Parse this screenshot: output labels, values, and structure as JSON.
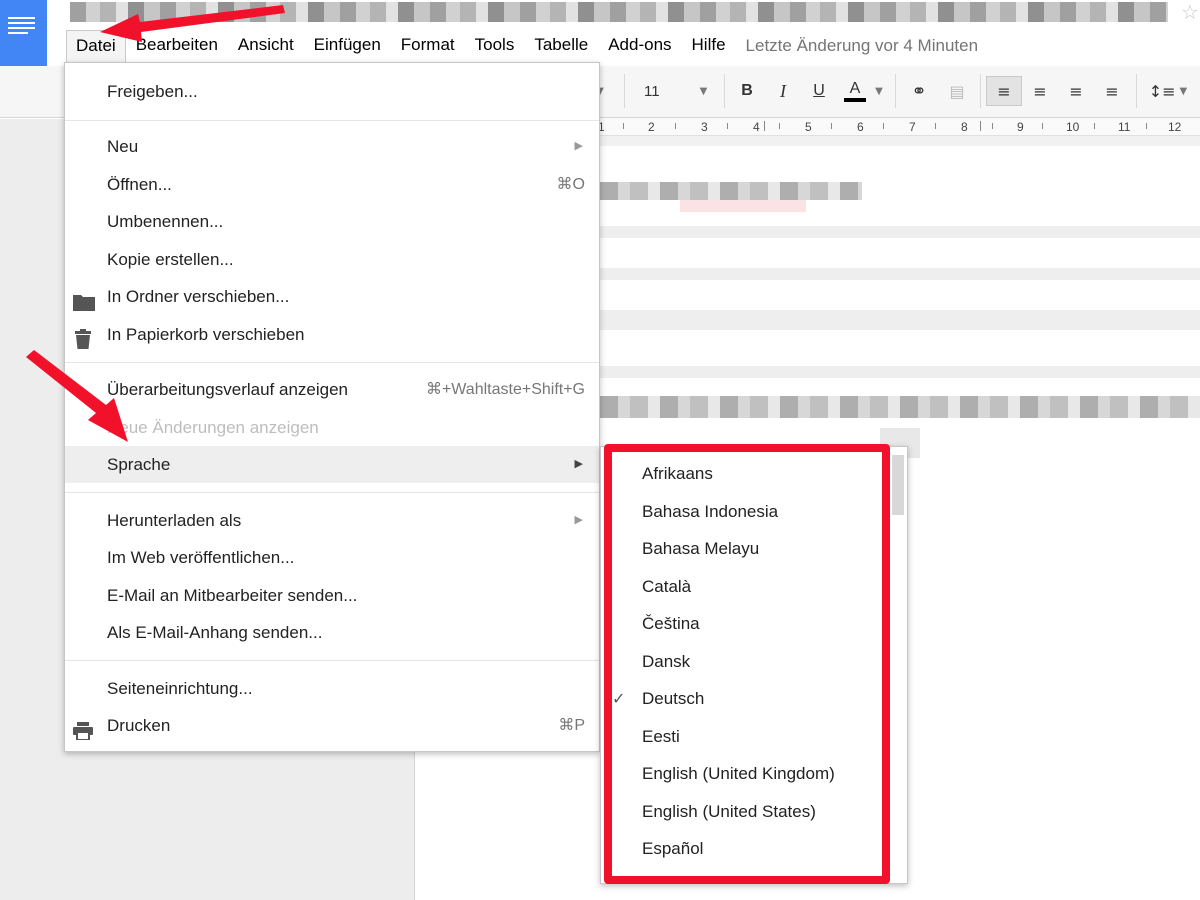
{
  "menubar": {
    "items": [
      "Datei",
      "Bearbeiten",
      "Ansicht",
      "Einfügen",
      "Format",
      "Tools",
      "Tabelle",
      "Add-ons",
      "Hilfe"
    ],
    "last_edit": "Letzte Änderung vor 4 Minuten"
  },
  "toolbar": {
    "font_size": "11",
    "bold": "B",
    "italic": "I",
    "underline": "U",
    "text_color": "A"
  },
  "ruler": {
    "labels": [
      "1",
      "2",
      "3",
      "4",
      "5",
      "6",
      "7",
      "8",
      "9",
      "10",
      "11",
      "12"
    ]
  },
  "file_menu": {
    "share": "Freigeben...",
    "new": "Neu",
    "open": "Öffnen...",
    "open_shortcut": "⌘O",
    "rename": "Umbenennen...",
    "copy": "Kopie erstellen...",
    "move_folder": "In Ordner verschieben...",
    "move_trash": "In Papierkorb verschieben",
    "revision_history": "Überarbeitungsverlauf anzeigen",
    "revision_shortcut": "⌘+Wahltaste+Shift+G",
    "new_changes": "Neue Änderungen anzeigen",
    "language": "Sprache",
    "download": "Herunterladen als",
    "publish": "Im Web veröffentlichen...",
    "email_collab": "E-Mail an Mitbearbeiter senden...",
    "email_attach": "Als E-Mail-Anhang senden...",
    "page_setup": "Seiteneinrichtung...",
    "print": "Drucken",
    "print_shortcut": "⌘P"
  },
  "language_menu": {
    "items": [
      "Afrikaans",
      "Bahasa Indonesia",
      "Bahasa Melayu",
      "Català",
      "Čeština",
      "Dansk",
      "Deutsch",
      "Eesti",
      "English (United Kingdom)",
      "English (United States)",
      "Español"
    ],
    "selected": "Deutsch"
  },
  "colors": {
    "brand_blue": "#4285f4",
    "annotation_red": "#f2112b"
  }
}
